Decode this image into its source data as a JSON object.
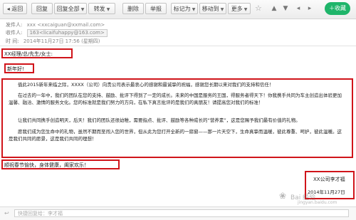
{
  "toolbar": {
    "back": "返回",
    "reply": "回复",
    "reply_all": "回复全部",
    "forward": "转发",
    "delete": "删除",
    "report": "举报",
    "mark_as": "标记为",
    "move_to": "移动到",
    "more": "更多",
    "save": "收藏"
  },
  "header": {
    "from_label": "发件人:",
    "from_value": "xxx <xxcaiguan@xxmail.com>",
    "to_label": "收件人:",
    "to_value": "163<licaifuhappy@163.com>",
    "time_label": "时 间:",
    "time_value": "2014年11月27日 17:56 (星期四)"
  },
  "body": {
    "greeting": "XX经理/总/先生/女士:",
    "new_year": "新年好!",
    "para1": "值此2015新年来临之际，XXXX（公司）向贵公司表示最衷心的感谢和最诚挚的祝福，感谢您长期以来对我们的支持和信任！",
    "para2": "在过去的一年中，我们的团队在您的支持、鼓励、批评下得到了一定的成长。未来的中国是服务的王国，得服务者得天下！你我携手共同为车主创造出体验更加温馨、融洽、激情的服务文化。您的标准就是我们努力的方向，在私下真言批评的是我们的真朋友！请提高您对我们的标准！",
    "para3": "让我们共同携手创造明天，后天！我们的团队还很幼稚，需要指点、批评、鼓励等各种成长的“营养素”，这是您赐予我们最有价值的礼物。",
    "para4": "愿我们成为您生命中的礼物，虽然不期而至闯入您的世界，但从此为您打开全新的一扇窗——那一片天空下，生命真挚而温暖，彼此尊重、呵护，彼此温暖。这是我们共同的愿景，这是我们共同的理想！",
    "wishes": "顺祝春节愉快，身体健康，阖家欢乐！",
    "signature": "XX公司李才福",
    "date": "2014年11月27日"
  },
  "watermark": {
    "brand": "Bai 经验",
    "sub": "jingyan.baidu.com"
  },
  "reply_box": {
    "placeholder": "快捷回复给：李才福"
  },
  "colors": {
    "highlight_border": "#d0141a",
    "save_button": "#1fb56a"
  }
}
